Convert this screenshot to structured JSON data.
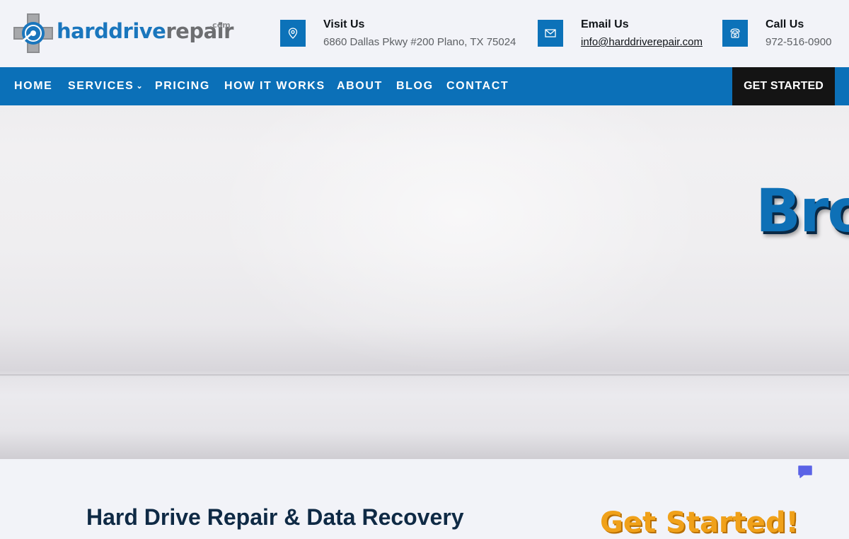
{
  "brand": {
    "wordmark_part1": "harddrive",
    "wordmark_part2": "repair",
    "wordmark_suffix": ".com",
    "logo_icon": "hard-drive-cross-icon"
  },
  "contacts": [
    {
      "icon": "map-pin-icon",
      "title": "Visit Us",
      "value": "6860 Dallas Pkwy #200 Plano, TX 75024"
    },
    {
      "icon": "envelope-icon",
      "title": "Email Us",
      "value": "info@harddriverepair.com"
    },
    {
      "icon": "telephone-icon",
      "title": "Call Us",
      "value": "972-516-0900"
    }
  ],
  "nav": {
    "items": [
      {
        "label": "HOME"
      },
      {
        "label": "SERVICES",
        "has_dropdown": true
      },
      {
        "label": "PRICING"
      },
      {
        "label": "HOW IT WORKS"
      },
      {
        "label": "ABOUT"
      },
      {
        "label": "BLOG"
      },
      {
        "label": "CONTACT"
      }
    ],
    "cta_label": "GET STARTED"
  },
  "hero": {
    "title_visible": "Bro"
  },
  "main": {
    "section_title": "Hard Drive Repair & Data Recovery",
    "promo_text": "Get Started!"
  },
  "chat": {
    "icon": "chat-bubble-icon"
  },
  "colors": {
    "primary_blue": "#0b70b8",
    "cta_black": "#141414",
    "page_bg": "#f2f3f8",
    "promo_orange": "#f0a11a"
  }
}
